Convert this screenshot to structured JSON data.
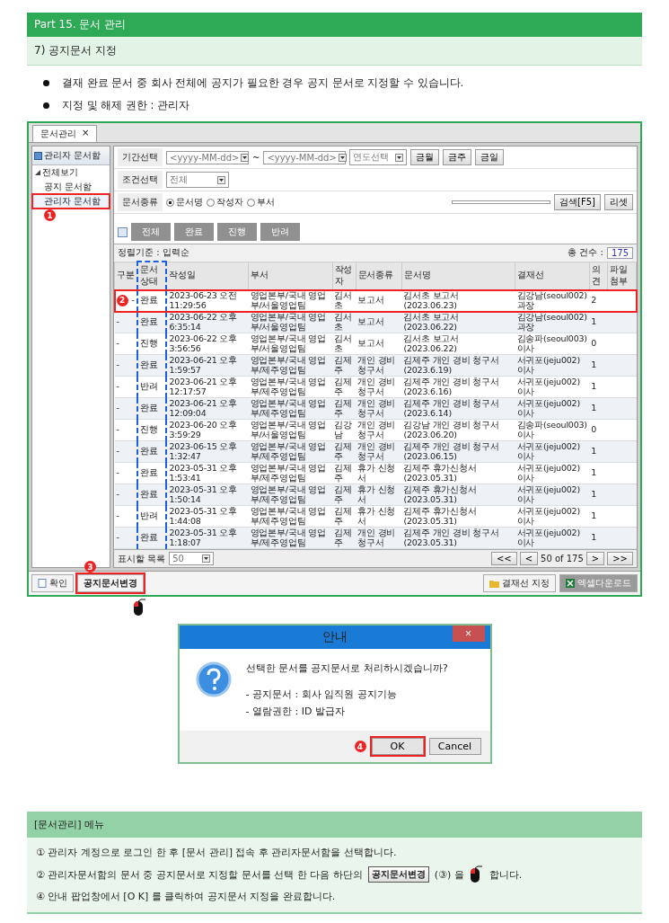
{
  "part_title": "Part 15. 문서 관리",
  "section_title": "7) 공지문서 지정",
  "bullets": [
    "결재 완료 문서 중 회사 전체에 공지가 필요한 경우 공지 문서로 지정할 수 있습니다.",
    "지정 및 해제 권한 : 관리자"
  ],
  "app": {
    "tab": {
      "label": "문서관리",
      "close": "×"
    },
    "sidebar": {
      "title": "관리자 문서함",
      "tree": [
        {
          "label": "전체보기",
          "expanded": true,
          "children": [
            {
              "label": "공지 문서함",
              "selected": false
            },
            {
              "label": "관리자 문서함",
              "selected": true,
              "marker": "1"
            }
          ]
        }
      ]
    },
    "filters": {
      "period_label": "기간선택",
      "date_from": "<yyyy-MM-dd>",
      "tilde": "~",
      "date_to": "<yyyy-MM-dd>",
      "year_select": "연도선택",
      "period_buttons": [
        "금월",
        "금주",
        "금일"
      ],
      "condition_label": "조건선택",
      "condition_value": "전체",
      "type_label": "문서종류",
      "type_options": [
        {
          "label": "문서명",
          "selected": true
        },
        {
          "label": "작성자",
          "selected": false
        },
        {
          "label": "부서",
          "selected": false
        }
      ],
      "search_button": "검색[F5]",
      "reset_button": "리셋"
    },
    "status_buttons": [
      "전체",
      "완료",
      "진행",
      "반려"
    ],
    "sort_label": "정렬기준 : 입력순",
    "total_label": "총 건수 :",
    "total_value": "175",
    "table": {
      "columns": [
        {
          "label": "구분",
          "highlighted": false
        },
        {
          "label": "문서상태",
          "highlighted": true
        },
        {
          "label": "작성일",
          "highlighted": false
        },
        {
          "label": "부서",
          "highlighted": false
        },
        {
          "label": "작성자",
          "highlighted": false
        },
        {
          "label": "문서종류",
          "highlighted": false
        },
        {
          "label": "문서명",
          "highlighted": false
        },
        {
          "label": "결재선",
          "highlighted": false
        },
        {
          "label": "의견",
          "highlighted": false
        },
        {
          "label": "파일첨부",
          "highlighted": false
        }
      ],
      "rows": [
        {
          "selected": true,
          "marker": "2",
          "cells": [
            "-",
            "완료",
            "2023-06-23 오전 11:29:56",
            "영업본부/국내 영업부/서울영업팀",
            "김서초",
            "보고서",
            "김서초 보고서 (2023.06.23)",
            "김강남(seoul002) 과장",
            "2",
            ""
          ]
        },
        {
          "selected": false,
          "cells": [
            "-",
            "완료",
            "2023-06-22 오후 6:35:14",
            "영업본부/국내 영업부/서울영업팀",
            "김서초",
            "보고서",
            "김서초 보고서 (2023.06.22)",
            "김강남(seoul002) 과장",
            "1",
            ""
          ]
        },
        {
          "selected": false,
          "cells": [
            "-",
            "진행",
            "2023-06-22 오후 3:56:56",
            "영업본부/국내 영업부/서울영업팀",
            "김서초",
            "보고서",
            "김서초 보고서 (2023.06.22)",
            "김송파(seoul003) 이사",
            "0",
            ""
          ]
        },
        {
          "selected": false,
          "cells": [
            "-",
            "완료",
            "2023-06-21 오후 1:59:57",
            "영업본부/국내 영업부/제주영업팀",
            "김제주",
            "개인 경비 청구서",
            "김제주 개인 경비 청구서 (2023.6.19)",
            "서귀포(jeju002) 이사",
            "1",
            ""
          ]
        },
        {
          "selected": false,
          "cells": [
            "-",
            "반려",
            "2023-06-21 오후 12:17:57",
            "영업본부/국내 영업부/제주영업팀",
            "김제주",
            "개인 경비 청구서",
            "김제주 개인 경비 청구서 (2023.6.16)",
            "서귀포(jeju002) 이사",
            "1",
            ""
          ]
        },
        {
          "selected": false,
          "cells": [
            "-",
            "완료",
            "2023-06-21 오후 12:09:04",
            "영업본부/국내 영업부/제주영업팀",
            "김제주",
            "개인 경비 청구서",
            "김제주 개인 경비 청구서 (2023.6.14)",
            "서귀포(jeju002) 이사",
            "1",
            ""
          ]
        },
        {
          "selected": false,
          "cells": [
            "-",
            "진행",
            "2023-06-20 오후 3:59:29",
            "영업본부/국내 영업부/서울영업팀",
            "김강남",
            "개인 경비 청구서",
            "김강남 개인 경비 청구서 (2023.06.20)",
            "김송파(seoul003) 이사",
            "0",
            ""
          ]
        },
        {
          "selected": false,
          "cells": [
            "-",
            "완료",
            "2023-06-15 오후 1:32:47",
            "영업본부/국내 영업부/제주영업팀",
            "김제주",
            "개인 경비 청구서",
            "김제주 개인 경비 청구서 (2023.06.15)",
            "서귀포(jeju002) 이사",
            "1",
            ""
          ]
        },
        {
          "selected": false,
          "cells": [
            "-",
            "완료",
            "2023-05-31 오후 1:53:41",
            "영업본부/국내 영업부/제주영업팀",
            "김제주",
            "휴가 신청서",
            "김제주 휴가신청서 (2023.05.31)",
            "서귀포(jeju002) 이사",
            "1",
            ""
          ]
        },
        {
          "selected": false,
          "cells": [
            "-",
            "완료",
            "2023-05-31 오후 1:50:14",
            "영업본부/국내 영업부/제주영업팀",
            "김제주",
            "휴가 신청서",
            "김제주 휴가신청서 (2023.05.31)",
            "서귀포(jeju002) 이사",
            "1",
            ""
          ]
        },
        {
          "selected": false,
          "cells": [
            "-",
            "반려",
            "2023-05-31 오후 1:44:08",
            "영업본부/국내 영업부/제주영업팀",
            "김제주",
            "휴가 신청서",
            "김제주 휴가신청서 (2023.05.31)",
            "서귀포(jeju002) 이사",
            "1",
            ""
          ]
        },
        {
          "selected": false,
          "cells": [
            "-",
            "완료",
            "2023-05-31 오후 1:18:07",
            "영업본부/국내 영업부/제주영업팀",
            "김제주",
            "개인 경비 청구서",
            "김제주 개인 경비 청구서 (2023.05.31)",
            "서귀포(jeju002) 이사",
            "1",
            ""
          ]
        }
      ]
    },
    "page_size_label": "표시할 목록",
    "page_size": "50",
    "pager": {
      "first": "<<",
      "prev": "<",
      "info": "50 of 175",
      "next": ">",
      "last": ">>"
    },
    "bottom_buttons": [
      {
        "kind": "confirm",
        "label": "확인"
      },
      {
        "kind": "notice",
        "label": "공지문서변경",
        "marker": "3"
      },
      {
        "kind": "approval",
        "label": "결재선 지정"
      },
      {
        "kind": "excel",
        "label": "엑셀다운로드"
      }
    ]
  },
  "dialog": {
    "title": "안내",
    "close": "×",
    "message": "선택한 문서를 공지문서로 처리하시겠습니까?",
    "lines": [
      "- 공지문서 : 회사 임직원 공지기능",
      "- 열람권한 : ID 발급자"
    ],
    "ok": "OK",
    "ok_marker": "4",
    "cancel": "Cancel"
  },
  "guide": {
    "title": "[문서관리] 메뉴",
    "steps": [
      {
        "kind": "text",
        "text": "① 관리자 계정으로 로그인 한 후 [문서 관리] 접속 후 관리자문서함을 선택합니다."
      },
      {
        "kind": "button",
        "before": "② 관리자문서함의 문서 중 공지문서로 지정할 문서를 선택 한 다음 하단의",
        "button": "공지문서변경",
        "middle": "(③) 을",
        "after": "합니다."
      },
      {
        "kind": "text",
        "text": "④ 안내 팝업창에서 [O K] 를 클릭하여 공지문서 지정을 완료합니다."
      }
    ]
  }
}
